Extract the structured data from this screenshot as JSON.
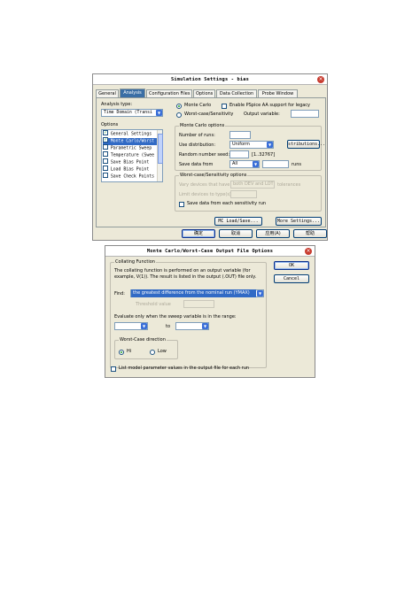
{
  "dialog1": {
    "title": "Simulation Settings - bias",
    "tabs": [
      "General",
      "Analysis",
      "Configuration Files",
      "Options",
      "Data Collection",
      "Probe Window"
    ],
    "analysis_type_label": "Analysis type:",
    "analysis_type_value": "Time Domain (Transi",
    "options_label": "Options",
    "options": [
      {
        "label": "General Settings",
        "checked": true
      },
      {
        "label": "Monte Carlo/Worst",
        "checked": true,
        "selected": true
      },
      {
        "label": "Parametric Sweep",
        "checked": false
      },
      {
        "label": "Temperature (Swee",
        "checked": false
      },
      {
        "label": "Save Bias Point",
        "checked": false
      },
      {
        "label": "Load Bias Point",
        "checked": false
      },
      {
        "label": "Save Check Points",
        "checked": false
      }
    ],
    "radio_monte_carlo": "Monte Carlo",
    "radio_worst_case": "Worst-case/Sensitivity",
    "enable_pspice_aa": "Enable PSpice AA support for legacy",
    "output_variable_label": "Output variable:",
    "output_variable_value": "",
    "monte_carlo_group": "Monte Carlo options",
    "number_of_runs_label": "Number of runs:",
    "number_of_runs_value": "",
    "use_distribution_label": "Use distribution:",
    "use_distribution_value": "Uniform",
    "distributions_button": "stributions...",
    "random_seed_label": "Random number seed:",
    "random_seed_value": "",
    "random_seed_range": "[1..32767]",
    "save_data_from_label": "Save data from",
    "save_data_from_value": "All",
    "save_data_runs_value": "",
    "runs_label": "runs",
    "worst_case_group": "Worst-case/Sensitivity options",
    "vary_devices_label": "Vary devices that have",
    "vary_devices_value": "both DEV and LOT",
    "tolerances_label": "tolerances",
    "limit_devices_label": "Limit devices to type(s)",
    "save_sensitivity_label": "Save data from each sensitivity run",
    "mc_load_save_button": "MC Load/Save...",
    "more_settings_button": "More Settings...",
    "ok_button": "确定",
    "cancel_button": "取消",
    "apply_button": "应用(A)",
    "help_button": "帮助"
  },
  "dialog2": {
    "title": "Monte Carlo/Worst-Case Output File Options",
    "collating_group": "Collating Function",
    "collating_description": "The collating function is performed on an output variable (for example, V(1)). The result is listed in the output (.OUT) file only.",
    "find_label": "Find:",
    "find_value": "the greatest difference from the nominal run (YMAX)",
    "threshold_label": "Threshold value",
    "threshold_value": "",
    "evaluate_label": "Evaluate only when the sweep variable is in the range:",
    "range_from_value": "",
    "to_label": "to",
    "range_to_value": "",
    "direction_group": "Worst-Case direction",
    "hi_label": "Hi",
    "low_label": "Low",
    "list_model_params_label": "List model parameter values in the output file for each run",
    "ok_button": "OK",
    "cancel_button": "Cancel"
  },
  "colors": {
    "dialog_bg": "#ece9d8",
    "selection": "#316ac5",
    "close_button": "#c83c30",
    "button_border": "#003c74"
  }
}
